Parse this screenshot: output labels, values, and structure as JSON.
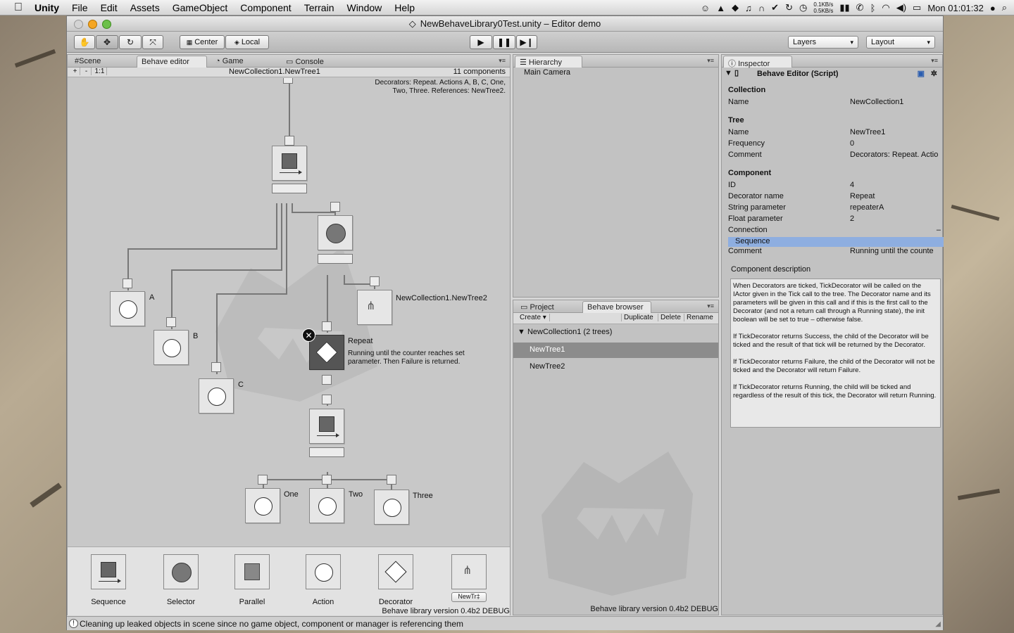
{
  "menubar": {
    "app": "Unity",
    "items": [
      "File",
      "Edit",
      "Assets",
      "GameObject",
      "Component",
      "Terrain",
      "Window",
      "Help"
    ],
    "net_up": "0.1KB/s",
    "net_down": "0.5KB/s",
    "clock": "Mon 01:01:32"
  },
  "window": {
    "title": "NewBehaveLibrary0Test.unity – Editor demo"
  },
  "toolbar": {
    "pivot_center": "Center",
    "pivot_local": "Local",
    "layers": "Layers",
    "layout": "Layout"
  },
  "editor": {
    "tabs": [
      "Scene",
      "Behave editor",
      "Game",
      "Console"
    ],
    "zoom_plus": "+",
    "zoom_minus": "-",
    "zoom_reset": "1:1",
    "tree_path": "NewCollection1.NewTree1",
    "component_count": "11 components",
    "summary_line1": "Decorators: Repeat. Actions A, B, C, One,",
    "summary_line2": "Two, Three. References: NewTree2.",
    "labels": {
      "a": "A",
      "b": "B",
      "c": "C",
      "ref": "NewCollection1.NewTree2",
      "repeat": "Repeat",
      "repeat_comment_1": "Running until the counter reaches set",
      "repeat_comment_2": "parameter. Then Failure is returned.",
      "one": "One",
      "two": "Two",
      "three": "Three"
    },
    "palette": {
      "sequence": "Sequence",
      "selector": "Selector",
      "parallel": "Parallel",
      "action": "Action",
      "decorator": "Decorator",
      "tree_popup": "NewTr"
    },
    "version": "Behave library version 0.4b2 DEBUG"
  },
  "hierarchy": {
    "tab": "Hierarchy",
    "items": [
      "Main Camera"
    ]
  },
  "browser": {
    "tabs": [
      "Project",
      "Behave browser"
    ],
    "create": "Create",
    "duplicate": "Duplicate",
    "delete": "Delete",
    "rename": "Rename",
    "collection": "NewCollection1 (2 trees)",
    "trees": [
      "NewTree1",
      "NewTree2"
    ],
    "version": "Behave library version 0.4b2 DEBUG"
  },
  "inspector": {
    "tab": "Inspector",
    "script": "Behave Editor (Script)",
    "collection_header": "Collection",
    "collection_name_label": "Name",
    "collection_name": "NewCollection1",
    "tree_header": "Tree",
    "tree_name_label": "Name",
    "tree_name": "NewTree1",
    "frequency_label": "Frequency",
    "frequency": "0",
    "tree_comment_label": "Comment",
    "tree_comment": "Decorators: Repeat. Actio",
    "component_header": "Component",
    "id_label": "ID",
    "id": "4",
    "decorator_name_label": "Decorator name",
    "decorator_name": "Repeat",
    "string_param_label": "String parameter",
    "string_param": "repeaterA",
    "float_param_label": "Float parameter",
    "float_param": "2",
    "connection_label": "Connection",
    "connection_value": "–",
    "connection_item": "Sequence",
    "comp_comment_label": "Comment",
    "comp_comment": "Running until the counte",
    "description_header": "Component description",
    "description": [
      "When Decorators are ticked, TickDecorator will be called on the IActor given in the Tick call to the tree. The Decorator name and its parameters will be given in this call and if this is the first call to the Decorator (and not a return call through a Running state), the init boolean will be set to true – otherwise false.",
      "If TickDecorator returns Success, the child of the Decorator will be ticked and the result of that tick will be returned by the Decorator.",
      "If TickDecorator returns Failure, the child of the Decorator will not be ticked and the Decorator will return Failure.",
      "If TickDecorator returns Running, the child will be ticked and regardless of the result of this tick, the Decorator will return Running."
    ]
  },
  "statusbar": {
    "message": "Cleaning up leaked objects in scene since no game object, component or manager is referencing them"
  }
}
